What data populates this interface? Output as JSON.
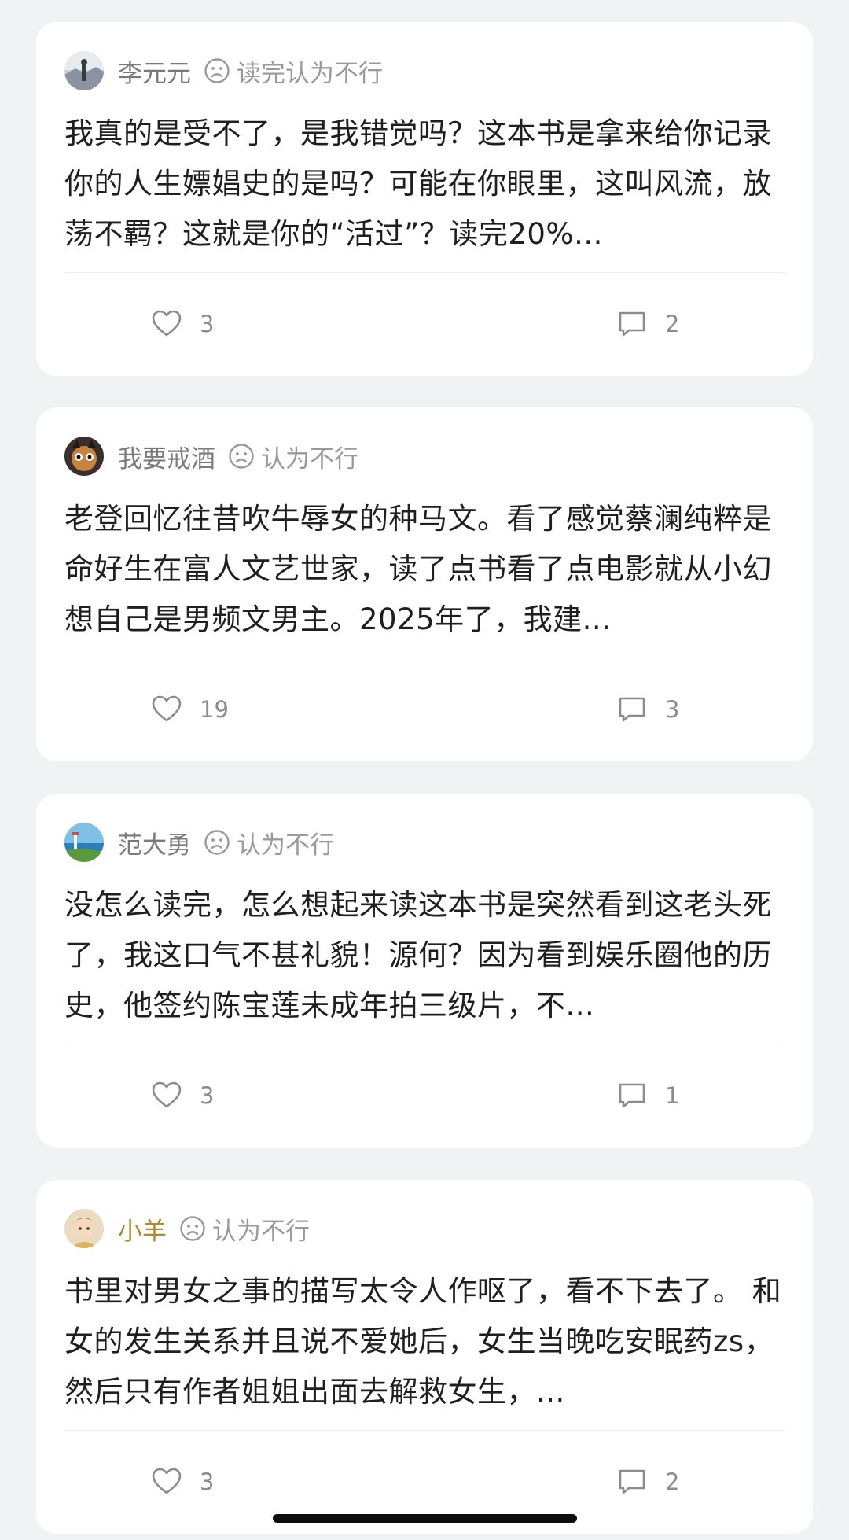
{
  "reviews": [
    {
      "username": "李元元",
      "rating_label": "读完认为不行",
      "avatar_icon": "avatar-landscape",
      "text": "我真的是受不了，是我错觉吗？这本书是拿来给你记录你的人生嫖娼史的是吗？可能在你眼里，这叫风流，放荡不羁？这就是你的“活过”？读完20%...",
      "likes": "3",
      "comments": "2"
    },
    {
      "username": "我要戒酒",
      "rating_label": "认为不行",
      "avatar_icon": "avatar-character",
      "text": "老登回忆往昔吹牛辱女的种马文。看了感觉蔡澜纯粹是命好生在富人文艺世家，读了点书看了点电影就从小幻想自己是男频文男主。2025年了，我建...",
      "likes": "19",
      "comments": "3"
    },
    {
      "username": "范大勇",
      "rating_label": "认为不行",
      "avatar_icon": "avatar-seaside",
      "text": "没怎么读完，怎么想起来读这本书是突然看到这老头死了，我这口气不甚礼貌！源何？因为看到娱乐圈他的历史，他签约陈宝莲未成年拍三级片，不...",
      "likes": "3",
      "comments": "1"
    },
    {
      "username": "小羊",
      "rating_label": "认为不行",
      "avatar_icon": "avatar-girl",
      "text": "书里对男女之事的描写太令人作呕了，看不下去了。 和女的发生关系并且说不爱她后，女生当晚吃安眠药zs，然后只有作者姐姐出面去解救女生，...",
      "likes": "3",
      "comments": "2"
    }
  ],
  "colors": {
    "background": "#eff3f4",
    "card": "#ffffff",
    "username": "#7a7a7a",
    "username_highlight": "#b08a2e",
    "muted": "#9a9a9a"
  },
  "icons": {
    "rating": "sad-face-icon",
    "like": "heart-icon",
    "comment": "comment-bubble-icon"
  }
}
